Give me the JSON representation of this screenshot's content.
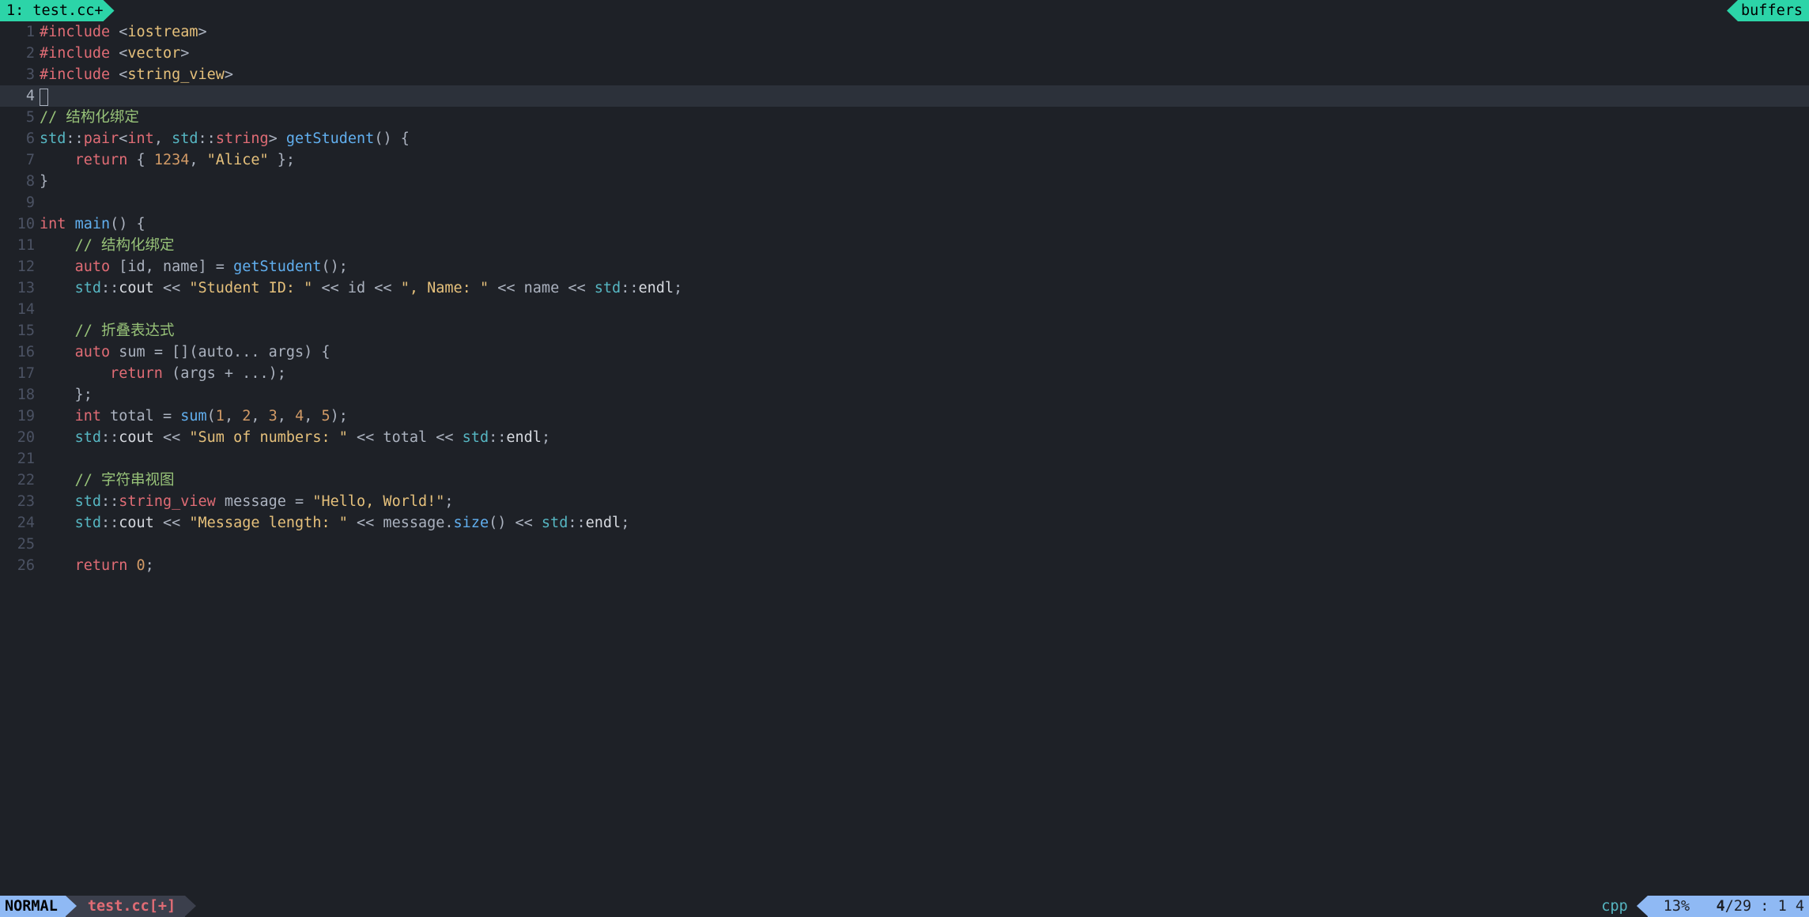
{
  "top": {
    "tab_label": "1: test.cc+",
    "buffers_label": "buffers"
  },
  "status": {
    "mode": "NORMAL",
    "filename": "test.cc[+]",
    "filetype": "cpp",
    "percent": "13%",
    "line_current": "4",
    "line_total": "29",
    "col_info": "1 4"
  },
  "cursor_line": 4,
  "lines": [
    {
      "n": 1,
      "tokens": [
        [
          "c-red",
          "#include "
        ],
        [
          "c-grey",
          "<"
        ],
        [
          "c-yellow",
          "iostream"
        ],
        [
          "c-grey",
          ">"
        ]
      ]
    },
    {
      "n": 2,
      "tokens": [
        [
          "c-red",
          "#include "
        ],
        [
          "c-grey",
          "<"
        ],
        [
          "c-yellow",
          "vector"
        ],
        [
          "c-grey",
          ">"
        ]
      ]
    },
    {
      "n": 3,
      "tokens": [
        [
          "c-red",
          "#include "
        ],
        [
          "c-grey",
          "<"
        ],
        [
          "c-yellow",
          "string_view"
        ],
        [
          "c-grey",
          ">"
        ]
      ]
    },
    {
      "n": 4,
      "tokens": [
        [
          "cursor",
          ""
        ]
      ]
    },
    {
      "n": 5,
      "tokens": [
        [
          "c-green",
          "// 结构化绑定"
        ]
      ]
    },
    {
      "n": 6,
      "tokens": [
        [
          "c-cyan",
          "std"
        ],
        [
          "c-grey",
          "::"
        ],
        [
          "c-red",
          "pair"
        ],
        [
          "c-grey",
          "<"
        ],
        [
          "c-red",
          "int"
        ],
        [
          "c-grey",
          ", "
        ],
        [
          "c-cyan",
          "std"
        ],
        [
          "c-grey",
          "::"
        ],
        [
          "c-red",
          "string"
        ],
        [
          "c-grey",
          "> "
        ],
        [
          "c-blue",
          "getStudent"
        ],
        [
          "c-grey",
          "() {"
        ]
      ]
    },
    {
      "n": 7,
      "tokens": [
        [
          "c-grey",
          "    "
        ],
        [
          "c-red",
          "return"
        ],
        [
          "c-grey",
          " { "
        ],
        [
          "c-orange",
          "1234"
        ],
        [
          "c-grey",
          ", "
        ],
        [
          "c-yellow",
          "\"Alice\""
        ],
        [
          "c-grey",
          " };"
        ]
      ]
    },
    {
      "n": 8,
      "tokens": [
        [
          "c-grey",
          "}"
        ]
      ]
    },
    {
      "n": 9,
      "tokens": []
    },
    {
      "n": 10,
      "tokens": [
        [
          "c-red",
          "int"
        ],
        [
          "c-grey",
          " "
        ],
        [
          "c-blue",
          "main"
        ],
        [
          "c-grey",
          "() {"
        ]
      ]
    },
    {
      "n": 11,
      "tokens": [
        [
          "c-grey",
          "    "
        ],
        [
          "c-green",
          "// 结构化绑定"
        ]
      ]
    },
    {
      "n": 12,
      "tokens": [
        [
          "c-grey",
          "    "
        ],
        [
          "c-red",
          "auto"
        ],
        [
          "c-grey",
          " [id, name] = "
        ],
        [
          "c-blue",
          "getStudent"
        ],
        [
          "c-grey",
          "();"
        ]
      ]
    },
    {
      "n": 13,
      "tokens": [
        [
          "c-grey",
          "    "
        ],
        [
          "c-cyan",
          "std"
        ],
        [
          "c-grey",
          "::"
        ],
        [
          "c-white",
          "cout"
        ],
        [
          "c-grey",
          " << "
        ],
        [
          "c-yellow",
          "\"Student ID: \""
        ],
        [
          "c-grey",
          " << id << "
        ],
        [
          "c-yellow",
          "\", Name: \""
        ],
        [
          "c-grey",
          " << name << "
        ],
        [
          "c-cyan",
          "std"
        ],
        [
          "c-grey",
          "::"
        ],
        [
          "c-white",
          "endl"
        ],
        [
          "c-grey",
          ";"
        ]
      ]
    },
    {
      "n": 14,
      "tokens": []
    },
    {
      "n": 15,
      "11_pad": true,
      "tokens": [
        [
          "c-grey",
          "    "
        ],
        [
          "c-green",
          "// 折叠表达式"
        ]
      ]
    },
    {
      "n": 16,
      "tokens": [
        [
          "c-grey",
          "    "
        ],
        [
          "c-red",
          "auto"
        ],
        [
          "c-grey",
          " sum = [](auto... args) {"
        ]
      ]
    },
    {
      "n": 17,
      "tokens": [
        [
          "c-grey",
          "        "
        ],
        [
          "c-red",
          "return"
        ],
        [
          "c-grey",
          " (args + ...);"
        ]
      ]
    },
    {
      "n": 18,
      "tokens": [
        [
          "c-grey",
          "    };"
        ]
      ]
    },
    {
      "n": 19,
      "tokens": [
        [
          "c-grey",
          "    "
        ],
        [
          "c-red",
          "int"
        ],
        [
          "c-grey",
          " total = "
        ],
        [
          "c-blue",
          "sum"
        ],
        [
          "c-grey",
          "("
        ],
        [
          "c-orange",
          "1"
        ],
        [
          "c-grey",
          ", "
        ],
        [
          "c-orange",
          "2"
        ],
        [
          "c-grey",
          ", "
        ],
        [
          "c-orange",
          "3"
        ],
        [
          "c-grey",
          ", "
        ],
        [
          "c-orange",
          "4"
        ],
        [
          "c-grey",
          ", "
        ],
        [
          "c-orange",
          "5"
        ],
        [
          "c-grey",
          ");"
        ]
      ]
    },
    {
      "n": 20,
      "tokens": [
        [
          "c-grey",
          "    "
        ],
        [
          "c-cyan",
          "std"
        ],
        [
          "c-grey",
          "::"
        ],
        [
          "c-white",
          "cout"
        ],
        [
          "c-grey",
          " << "
        ],
        [
          "c-yellow",
          "\"Sum of numbers: \""
        ],
        [
          "c-grey",
          " << total << "
        ],
        [
          "c-cyan",
          "std"
        ],
        [
          "c-grey",
          "::"
        ],
        [
          "c-white",
          "endl"
        ],
        [
          "c-grey",
          ";"
        ]
      ]
    },
    {
      "n": 21,
      "tokens": []
    },
    {
      "n": 22,
      "tokens": [
        [
          "c-grey",
          "    "
        ],
        [
          "c-green",
          "// 字符串视图"
        ]
      ]
    },
    {
      "n": 23,
      "tokens": [
        [
          "c-grey",
          "    "
        ],
        [
          "c-cyan",
          "std"
        ],
        [
          "c-grey",
          "::"
        ],
        [
          "c-red",
          "string_view"
        ],
        [
          "c-grey",
          " message = "
        ],
        [
          "c-yellow",
          "\"Hello, World!\""
        ],
        [
          "c-grey",
          ";"
        ]
      ]
    },
    {
      "n": 24,
      "tokens": [
        [
          "c-grey",
          "    "
        ],
        [
          "c-cyan",
          "std"
        ],
        [
          "c-grey",
          "::"
        ],
        [
          "c-white",
          "cout"
        ],
        [
          "c-grey",
          " << "
        ],
        [
          "c-yellow",
          "\"Message length: \""
        ],
        [
          "c-grey",
          " << message."
        ],
        [
          "c-blue",
          "size"
        ],
        [
          "c-grey",
          "() << "
        ],
        [
          "c-cyan",
          "std"
        ],
        [
          "c-grey",
          "::"
        ],
        [
          "c-white",
          "endl"
        ],
        [
          "c-grey",
          ";"
        ]
      ]
    },
    {
      "n": 25,
      "tokens": []
    },
    {
      "n": 26,
      "tokens": [
        [
          "c-grey",
          "    "
        ],
        [
          "c-red",
          "return"
        ],
        [
          "c-grey",
          " "
        ],
        [
          "c-orange",
          "0"
        ],
        [
          "c-grey",
          ";"
        ]
      ]
    }
  ]
}
